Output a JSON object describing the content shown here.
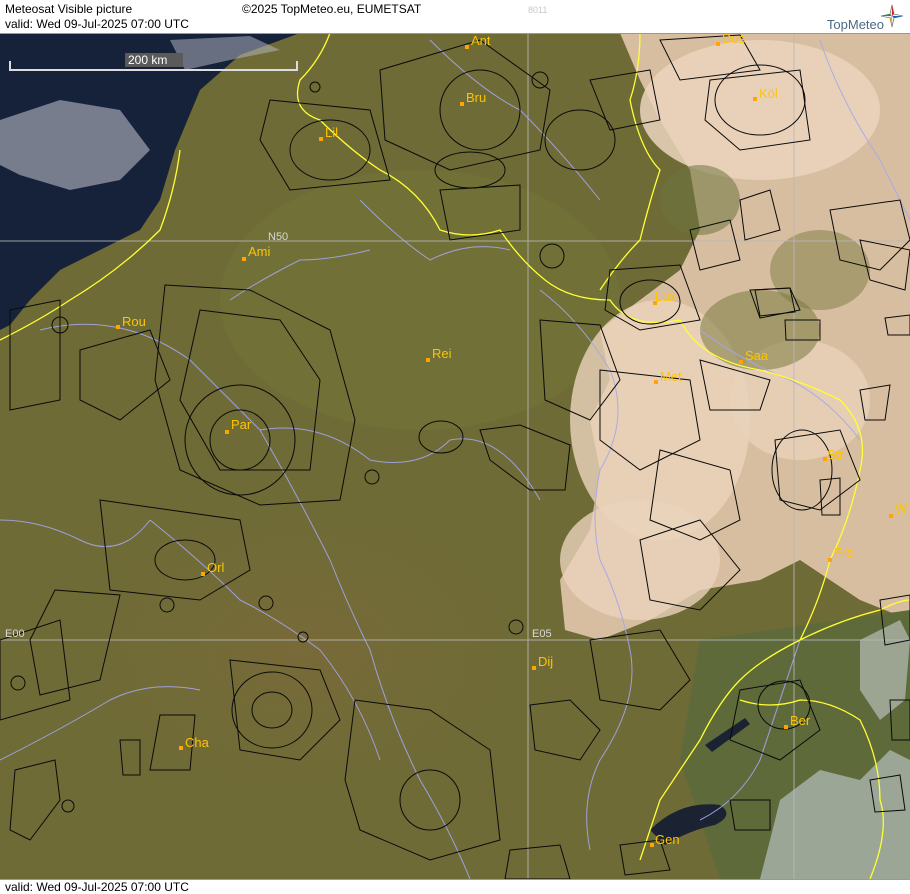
{
  "header": {
    "title": "Meteosat Visible picture",
    "valid": "valid:  Wed  09-Jul-2025  07:00 UTC",
    "copyright": "©2025 TopMeteo.eu, EUMETSAT",
    "id_code": "8011",
    "logo": "TopMeteo",
    "logo_icon": "compass-star-icon"
  },
  "footer": {
    "valid": "valid:  Wed  09-Jul-2025  07:00 UTC"
  },
  "scale": {
    "label": "200 km"
  },
  "grid": {
    "lat_label": "N50",
    "lon_labels": [
      "E00",
      "E05"
    ]
  },
  "cities": [
    {
      "name": "Ant"
    },
    {
      "name": "Bru"
    },
    {
      "name": "Dus"
    },
    {
      "name": "Köl"
    },
    {
      "name": "Lil"
    },
    {
      "name": "Ami"
    },
    {
      "name": "Rou"
    },
    {
      "name": "Lux"
    },
    {
      "name": "Rei"
    },
    {
      "name": "Saa"
    },
    {
      "name": "Met"
    },
    {
      "name": "Par"
    },
    {
      "name": "Str"
    },
    {
      "name": "Fre"
    },
    {
      "name": "Orl"
    },
    {
      "name": "Dij"
    },
    {
      "name": "Ber"
    },
    {
      "name": "Cha"
    },
    {
      "name": "Gen"
    },
    {
      "name": "W"
    }
  ],
  "colors": {
    "land": "#6e6b36",
    "sea": "#16223a",
    "cloud": "#e6cdb4",
    "border": "#ffff33",
    "river": "#a4a6ee",
    "airspace": "#0a0a0a",
    "grid": "#b8b8b8",
    "city_marker": "#ffa500",
    "city_label": "#ffc400"
  }
}
